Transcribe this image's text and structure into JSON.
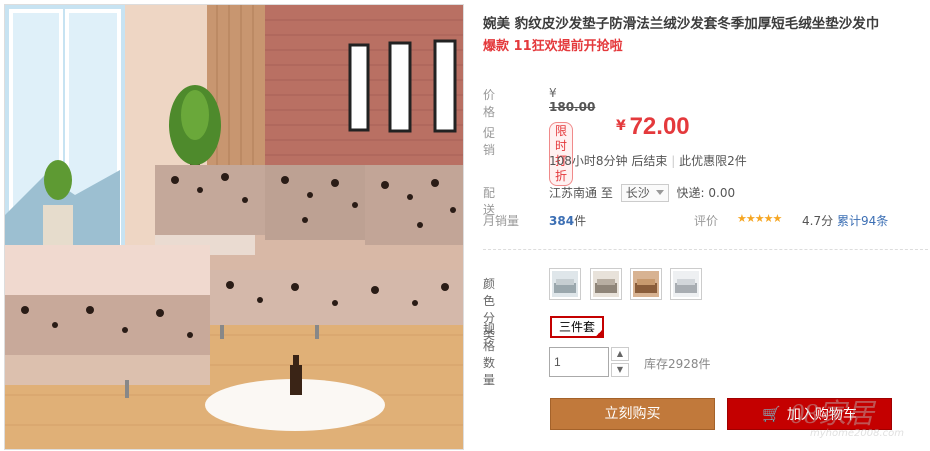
{
  "product": {
    "title": "婉美 豹纹皮沙发垫子防滑法兰绒沙发套冬季加厚短毛绒坐垫沙发巾",
    "promo": "爆款 11狂欢提前开抢啦"
  },
  "price": {
    "label": "价格",
    "original_currency": "¥",
    "original": "180.00"
  },
  "promotion": {
    "label": "促销",
    "badge": "限时打折",
    "currency": "¥",
    "amount": "72.00",
    "timer": "108小时8分钟 后结束",
    "limit": "此优惠限2件"
  },
  "delivery": {
    "label": "配送",
    "from": "江苏南通",
    "to_word": "至",
    "destination": "长沙",
    "fee": "快递: 0.00"
  },
  "sales": {
    "label": "月销量",
    "count": "384",
    "unit": "件",
    "rating_label": "评价",
    "stars": "★★★★★",
    "rating_value": 4.7,
    "score": "4.7分",
    "reviews": "累计94条"
  },
  "options": {
    "color_label": "颜色分类",
    "swatches": [
      "swatch-1",
      "swatch-2",
      "swatch-3",
      "swatch-4"
    ],
    "spec_label": "规格",
    "spec_selected": "三件套",
    "qty_label": "数量",
    "qty_value": "1",
    "stock": "库存2928件"
  },
  "actions": {
    "buy_now": "立刻购买",
    "add_to_cart": "加入购物车"
  },
  "watermark": {
    "text": "08家居",
    "url": "myhome2008.com"
  },
  "colors": {
    "accent": "#c40000",
    "price": "#e4393c",
    "buy_button": "#c1793b",
    "link": "#3c6fb4",
    "star": "#f6a623"
  }
}
